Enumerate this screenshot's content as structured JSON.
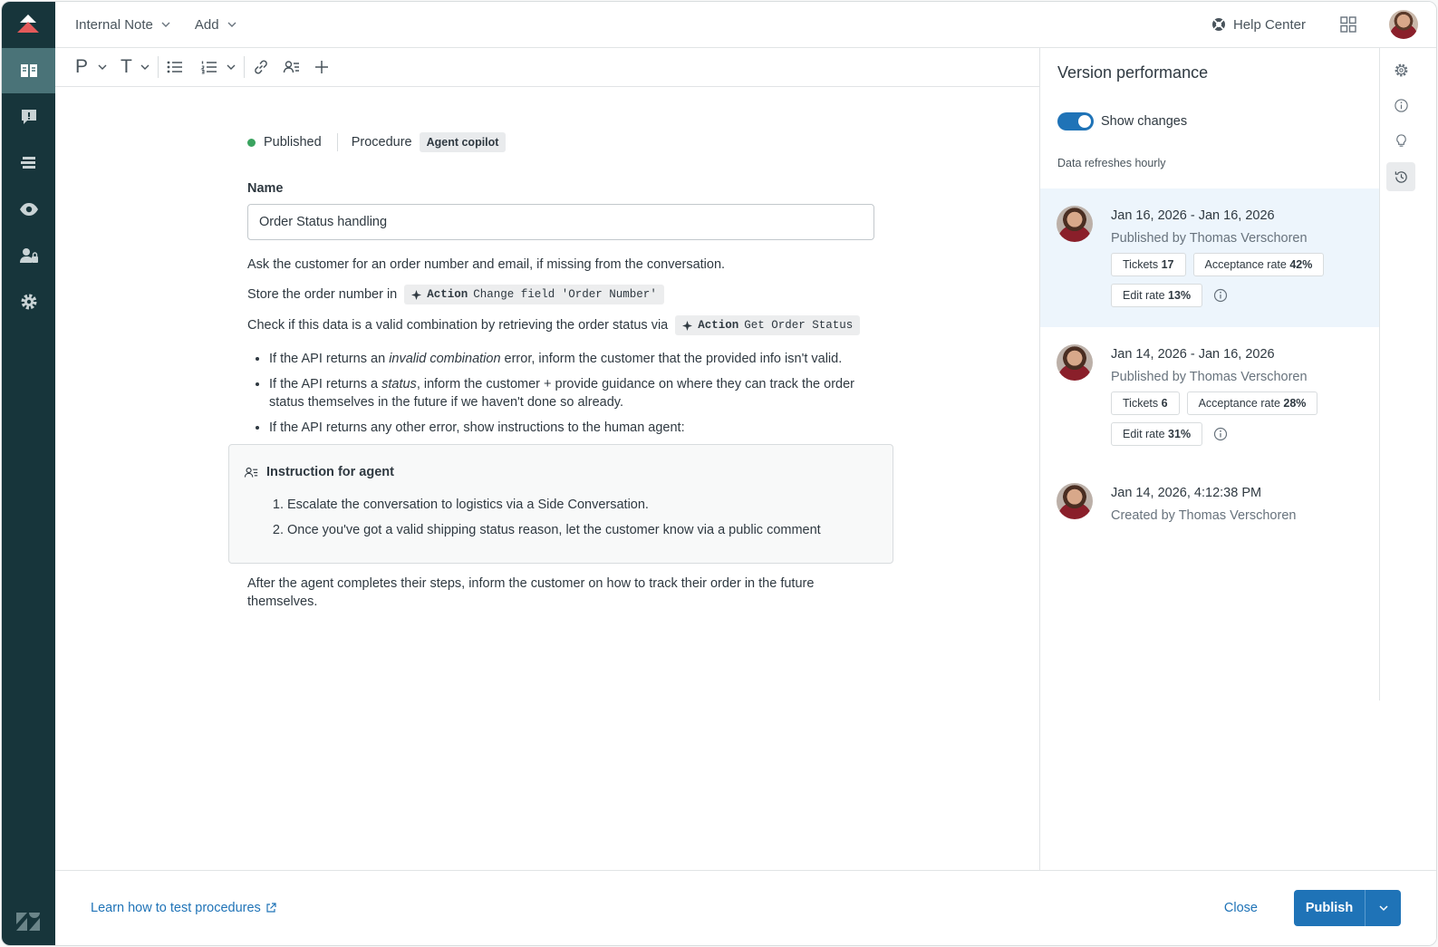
{
  "topbar": {
    "menu1": "Internal Note",
    "menu2": "Add",
    "help_center": "Help Center"
  },
  "toolbar": {
    "paragraph_glyph": "P",
    "text_glyph": "T"
  },
  "editor": {
    "status": "Published",
    "type": "Procedure",
    "tag": "Agent copilot",
    "name_label": "Name",
    "name_value": "Order Status handling",
    "para1": "Ask the customer for an order number and email, if missing from the conversation.",
    "para2_prefix": "Store the order number in",
    "action1_label": "Action",
    "action1_text": "Change field 'Order Number'",
    "para3_prefix": "Check if this data is a valid combination by retrieving the order status via",
    "action2_label": "Action",
    "action2_text": "Get Order Status",
    "bullet1_a": "If the API returns an ",
    "bullet1_em": "invalid combination",
    "bullet1_b": " error, inform the customer that the provided info isn't valid.",
    "bullet2_a": "If the API returns a ",
    "bullet2_em": "status",
    "bullet2_b": ", inform the customer + provide guidance on where they can track the order status themselves in the future if we haven't done so already.",
    "bullet3": "If the API returns any other error, show instructions to the human agent:",
    "instruction_title": "Instruction for agent",
    "instruction_items": [
      "Escalate the conversation to logistics via a Side Conversation.",
      "Once you've got a valid shipping status reason, let the customer know via a public comment"
    ],
    "after": "After the agent completes their steps, inform the customer on how to track their order in the future themselves."
  },
  "footer": {
    "learn_link": "Learn how to test procedures",
    "close": "Close",
    "publish": "Publish"
  },
  "panel": {
    "title": "Version performance",
    "toggle_label": "Show changes",
    "toggle_on": true,
    "refresh_note": "Data refreshes hourly",
    "versions": [
      {
        "date": "Jan 16, 2026 - Jan 16, 2026",
        "by": "Published by Thomas Verschoren",
        "tickets_label": "Tickets",
        "tickets": "17",
        "acceptance_label": "Acceptance rate",
        "acceptance": "42%",
        "edit_label": "Edit rate",
        "edit": "13%"
      },
      {
        "date": "Jan 14, 2026 - Jan 16, 2026",
        "by": "Published by Thomas Verschoren",
        "tickets_label": "Tickets",
        "tickets": "6",
        "acceptance_label": "Acceptance rate",
        "acceptance": "28%",
        "edit_label": "Edit rate",
        "edit": "31%"
      },
      {
        "date": "Jan 14, 2026, 4:12:38 PM",
        "by": "Created by Thomas Verschoren"
      }
    ]
  },
  "colors": {
    "rail": "#17353b",
    "rail_active": "#4a7378",
    "accent": "#1f73b7",
    "published_dot": "#3aa35f",
    "selected_version": "#edf5fc"
  }
}
